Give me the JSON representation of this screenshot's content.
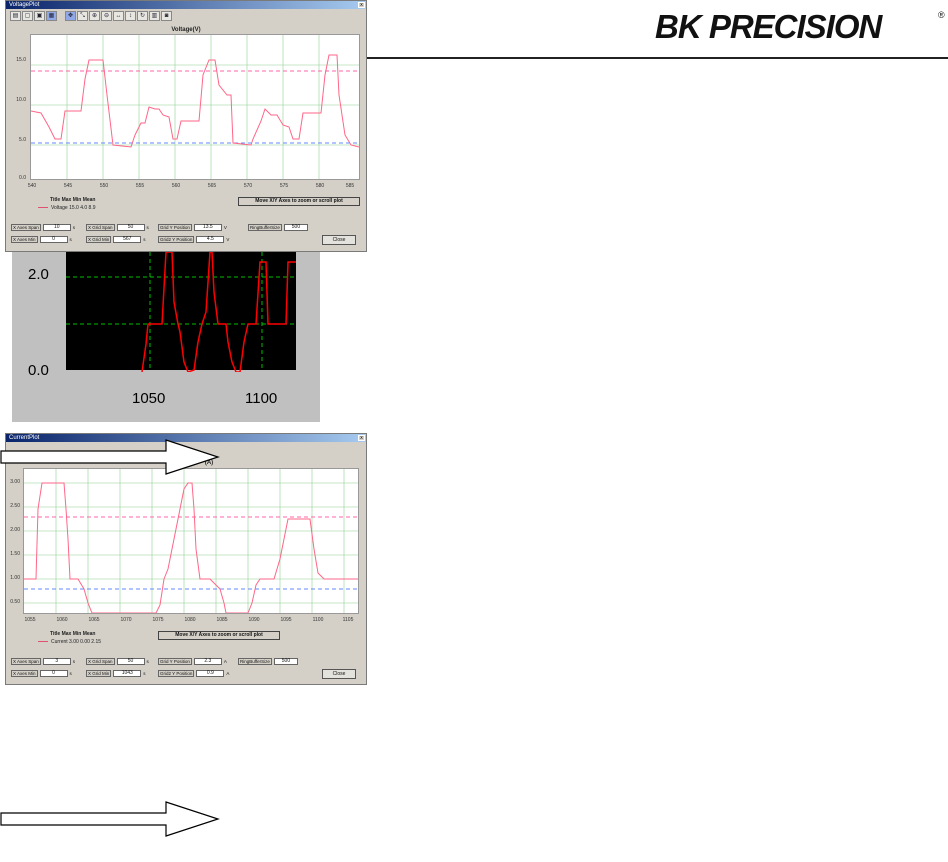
{
  "brand": {
    "logo_text": "BK PRECISION",
    "registered_mark": "®"
  },
  "arrow_icons": [
    "right-arrow-icon",
    "right-arrow-icon"
  ],
  "voltage_window": {
    "title": "VoltagePlot",
    "toolbar_icons": [
      "print-icon",
      "copy-icon",
      "save-icon",
      "zoom-box-icon",
      "pan-icon",
      "move-icon",
      "zoom-in-icon",
      "zoom-out-icon",
      "zoom-x-icon",
      "zoom-y-icon",
      "redraw-icon",
      "print-preview-icon",
      "disk-icon"
    ],
    "plot_title": "Voltage(V)",
    "y_ticks": [
      "15.0",
      "10.0",
      "5.0",
      "0.0"
    ],
    "x_ticks": [
      "540",
      "545",
      "550",
      "555",
      "560",
      "565",
      "570",
      "575",
      "580",
      "585"
    ],
    "legend_header": "Title   Max Min Mean",
    "legend_entry": "Voltage 15.0  4.0    8.9",
    "hint": "Move X/Y Axes to zoom or scroll plot",
    "fields_row1": [
      {
        "label": "X Axes Span",
        "value": "10",
        "unit": "s"
      },
      {
        "label": "X Grid Span",
        "value": "50",
        "unit": "s"
      },
      {
        "label": "Grid Y Position",
        "value": "13.5",
        "unit": "V"
      },
      {
        "label": "RingBufferSize",
        "value": "500",
        "unit": ""
      }
    ],
    "fields_row2": [
      {
        "label": "X Axes Min",
        "value": "0",
        "unit": "s"
      },
      {
        "label": "X Grid Min",
        "value": "567",
        "unit": "s"
      },
      {
        "label": "Grid2 Y Position",
        "value": "4.5",
        "unit": "V"
      }
    ],
    "close_label": "Close",
    "colors": {
      "trace": "#ff6688",
      "grid": "#00aa00",
      "marker_upper": "#ff66aa",
      "marker_lower": "#6688ff"
    }
  },
  "zoom_panel": {
    "y_ticks": [
      "2.0",
      "0.0"
    ],
    "x_ticks": [
      "1050",
      "1100"
    ],
    "colors": {
      "background": "#000000",
      "trace": "#ff0000",
      "grid": "#00c000",
      "frame": "#c0c0c0"
    }
  },
  "current_window": {
    "title": "CurrentPlot",
    "plot_title_fragment": "(A)",
    "y_ticks": [
      "3.00",
      "2.50",
      "2.00",
      "1.50",
      "1.00",
      "0.50"
    ],
    "x_ticks": [
      "1055",
      "1060",
      "1065",
      "1070",
      "1075",
      "1080",
      "1085",
      "1090",
      "1095",
      "1100",
      "1105"
    ],
    "legend_header": "Title   Max Min Mean",
    "legend_entry": "Current 3.00 0.00  2.15",
    "hint": "Move X/Y Axes to zoom or scroll plot",
    "fields_row1": [
      {
        "label": "X Axes Span",
        "value": "3",
        "unit": "s"
      },
      {
        "label": "X Grid Span",
        "value": "50",
        "unit": "s"
      },
      {
        "label": "Grid Y Position",
        "value": "2.3",
        "unit": "A"
      },
      {
        "label": "RingBufferSize",
        "value": "500",
        "unit": ""
      }
    ],
    "fields_row2": [
      {
        "label": "X Axes Min",
        "value": "0",
        "unit": "s"
      },
      {
        "label": "X Grid Min",
        "value": "1043",
        "unit": "s"
      },
      {
        "label": "Grid2 Y Position",
        "value": "0.9",
        "unit": "A"
      }
    ],
    "close_label": "Close"
  }
}
